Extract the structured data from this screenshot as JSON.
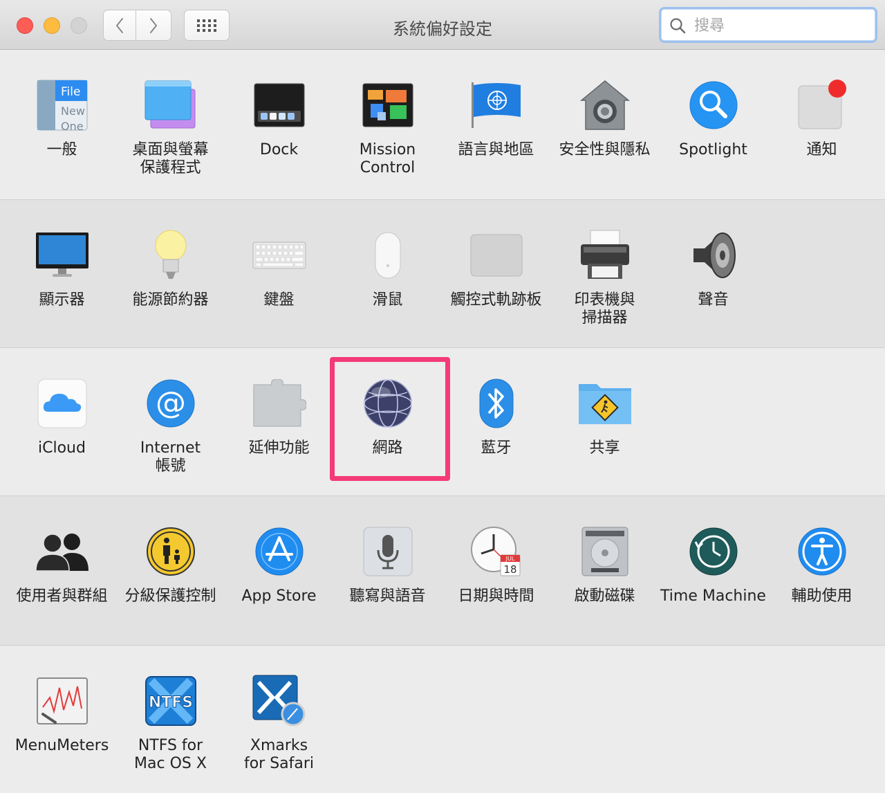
{
  "window": {
    "title": "系統偏好設定"
  },
  "search": {
    "placeholder": "搜尋",
    "value": ""
  },
  "highlight_color": "#f43a77",
  "rows": [
    [
      {
        "label": "一般",
        "icon": "general-icon"
      },
      {
        "label": "桌面與螢幕\n保護程式",
        "icon": "desktop-screensaver-icon"
      },
      {
        "label": "Dock",
        "icon": "dock-icon"
      },
      {
        "label": "Mission\nControl",
        "icon": "mission-control-icon"
      },
      {
        "label": "語言與地區",
        "icon": "language-region-icon"
      },
      {
        "label": "安全性與隱私",
        "icon": "security-privacy-icon"
      },
      {
        "label": "Spotlight",
        "icon": "spotlight-icon"
      },
      {
        "label": "通知",
        "icon": "notifications-icon"
      }
    ],
    [
      {
        "label": "顯示器",
        "icon": "displays-icon"
      },
      {
        "label": "能源節約器",
        "icon": "energy-saver-icon"
      },
      {
        "label": "鍵盤",
        "icon": "keyboard-icon"
      },
      {
        "label": "滑鼠",
        "icon": "mouse-icon"
      },
      {
        "label": "觸控式軌跡板",
        "icon": "trackpad-icon"
      },
      {
        "label": "印表機與\n掃描器",
        "icon": "printer-scanner-icon"
      },
      {
        "label": "聲音",
        "icon": "sound-icon"
      }
    ],
    [
      {
        "label": "iCloud",
        "icon": "icloud-icon"
      },
      {
        "label": "Internet\n帳號",
        "icon": "internet-accounts-icon"
      },
      {
        "label": "延伸功能",
        "icon": "extensions-icon"
      },
      {
        "label": "網路",
        "icon": "network-icon"
      },
      {
        "label": "藍牙",
        "icon": "bluetooth-icon"
      },
      {
        "label": "共享",
        "icon": "sharing-icon"
      }
    ],
    [
      {
        "label": "使用者與群組",
        "icon": "users-groups-icon"
      },
      {
        "label": "分級保護控制",
        "icon": "parental-controls-icon"
      },
      {
        "label": "App Store",
        "icon": "app-store-icon"
      },
      {
        "label": "聽寫與語音",
        "icon": "dictation-speech-icon"
      },
      {
        "label": "日期與時間",
        "icon": "date-time-icon"
      },
      {
        "label": "啟動磁碟",
        "icon": "startup-disk-icon"
      },
      {
        "label": "Time Machine",
        "icon": "time-machine-icon"
      },
      {
        "label": "輔助使用",
        "icon": "accessibility-icon"
      }
    ],
    [
      {
        "label": "MenuMeters",
        "icon": "menumeters-icon"
      },
      {
        "label": "NTFS for\nMac OS X",
        "icon": "ntfs-icon"
      },
      {
        "label": "Xmarks\nfor Safari",
        "icon": "xmarks-icon"
      }
    ]
  ],
  "icon_text": {
    "general": [
      "File",
      "New",
      "One"
    ],
    "ntfs": "NTFS",
    "calendar_month": "JUL",
    "calendar_day": "18"
  }
}
